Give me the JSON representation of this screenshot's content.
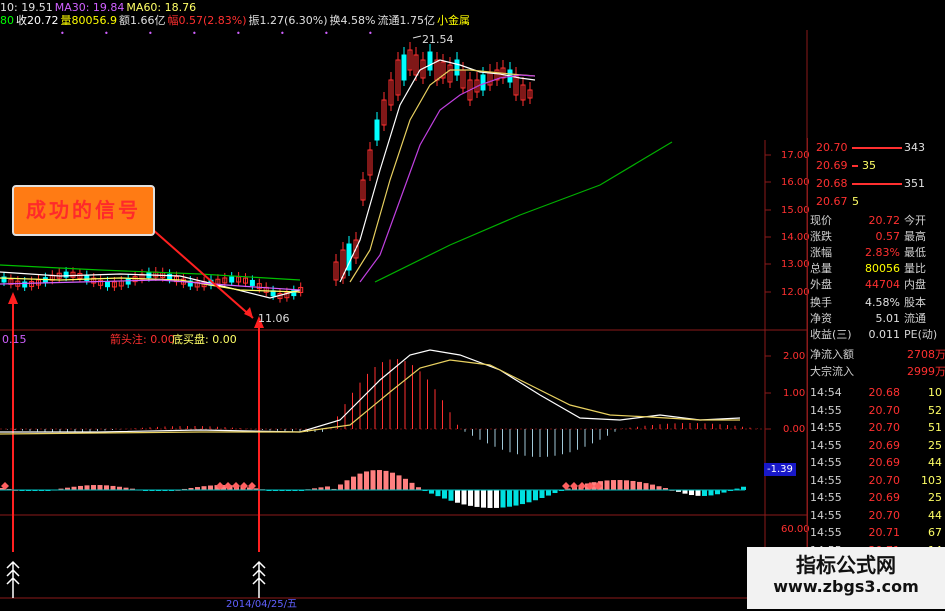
{
  "header": {
    "line1": [
      {
        "text": "10: 19.51",
        "color": "#e0e0e0"
      },
      {
        "text": "MA30: 19.84",
        "color": "#d060ff"
      },
      {
        "text": "MA60: 18.76",
        "color": "#ffff66"
      }
    ],
    "line2": [
      {
        "text": "80",
        "color": "#00ff00"
      },
      {
        "text": "收20.72",
        "color": "#ffffff"
      },
      {
        "text": "量80056.9",
        "color": "#ffff00"
      },
      {
        "text": "额1.66亿",
        "color": "#e0e0e0"
      },
      {
        "text": "幅0.57(2.83%)",
        "color": "#ff3030"
      },
      {
        "text": "振1.27(6.30%)",
        "color": "#e0e0e0"
      },
      {
        "text": "换4.58%",
        "color": "#e0e0e0"
      },
      {
        "text": "流通1.75亿",
        "color": "#e0e0e0"
      },
      {
        "text": "小金属",
        "color": "#ffff00"
      }
    ]
  },
  "annotations": {
    "high_price": "21.54",
    "low_price": "11.06",
    "signal_label": "成功的信号",
    "subchart_left_value": "0.15",
    "subchart_text1": "箭头注: 0.00",
    "subchart_text2": "底买盘: 0.00",
    "date_label": "2014/04/25/五"
  },
  "price_axis": [
    "17.00",
    "16.00",
    "15.00",
    "14.00",
    "13.00",
    "12.00"
  ],
  "macd_axis": [
    "2.00",
    "1.00",
    "0.00",
    "-1.39"
  ],
  "bottom_axis": [
    "60.00"
  ],
  "order_book": [
    {
      "price": "20.70",
      "vol": "343",
      "color": "#ff3030",
      "bar": "long"
    },
    {
      "price": "20.69",
      "vol": "35",
      "color": "#ff3030",
      "bar": "short"
    },
    {
      "price": "20.68",
      "vol": "351",
      "color": "#ff3030",
      "bar": "long"
    },
    {
      "price": "20.67",
      "vol": "5",
      "color": "#ff3030",
      "bar": "none"
    }
  ],
  "quote": [
    {
      "label": "现价",
      "value": "20.72",
      "value_color": "#ff3030",
      "label2": "今开"
    },
    {
      "label": "涨跌",
      "value": "0.57",
      "value_color": "#ff3030",
      "label2": "最高"
    },
    {
      "label": "涨幅",
      "value": "2.83%",
      "value_color": "#ff3030",
      "label2": "最低"
    },
    {
      "label": "总量",
      "value": "80056",
      "value_color": "#ffff00",
      "label2": "量比"
    },
    {
      "label": "外盘",
      "value": "44704",
      "value_color": "#ff3030",
      "label2": "内盘"
    },
    {
      "label": "换手",
      "value": "4.58%",
      "value_color": "#e0e0e0",
      "label2": "股本"
    },
    {
      "label": "净资",
      "value": "5.01",
      "value_color": "#e0e0e0",
      "label2": "流通"
    },
    {
      "label": "收益(三)",
      "value": "0.011",
      "value_color": "#e0e0e0",
      "label2": "PE(动)"
    }
  ],
  "flows": [
    {
      "label": "净流入额",
      "value": "2708万"
    },
    {
      "label": "大宗流入",
      "value": "2999万"
    }
  ],
  "ticks": [
    {
      "time": "14:54",
      "price": "20.68",
      "vol": "10"
    },
    {
      "time": "14:55",
      "price": "20.70",
      "vol": "52"
    },
    {
      "time": "14:55",
      "price": "20.70",
      "vol": "51"
    },
    {
      "time": "14:55",
      "price": "20.69",
      "vol": "25"
    },
    {
      "time": "14:55",
      "price": "20.69",
      "vol": "44"
    },
    {
      "time": "14:55",
      "price": "20.70",
      "vol": "103"
    },
    {
      "time": "14:55",
      "price": "20.69",
      "vol": "25"
    },
    {
      "time": "14:55",
      "price": "20.70",
      "vol": "44"
    },
    {
      "time": "14:55",
      "price": "20.71",
      "vol": "67"
    },
    {
      "time": "14:55",
      "price": "20.71",
      "vol": "14"
    }
  ],
  "watermark": {
    "title": "指标公式网",
    "url": "www.zbgs3.com"
  },
  "colors": {
    "up": "#ff3030",
    "down": "#00ffff",
    "grid": "#8b1a1a",
    "ma5": "#ffffff",
    "ma10": "#ffff66",
    "ma30": "#d060ff",
    "ma60": "#00c000"
  }
}
